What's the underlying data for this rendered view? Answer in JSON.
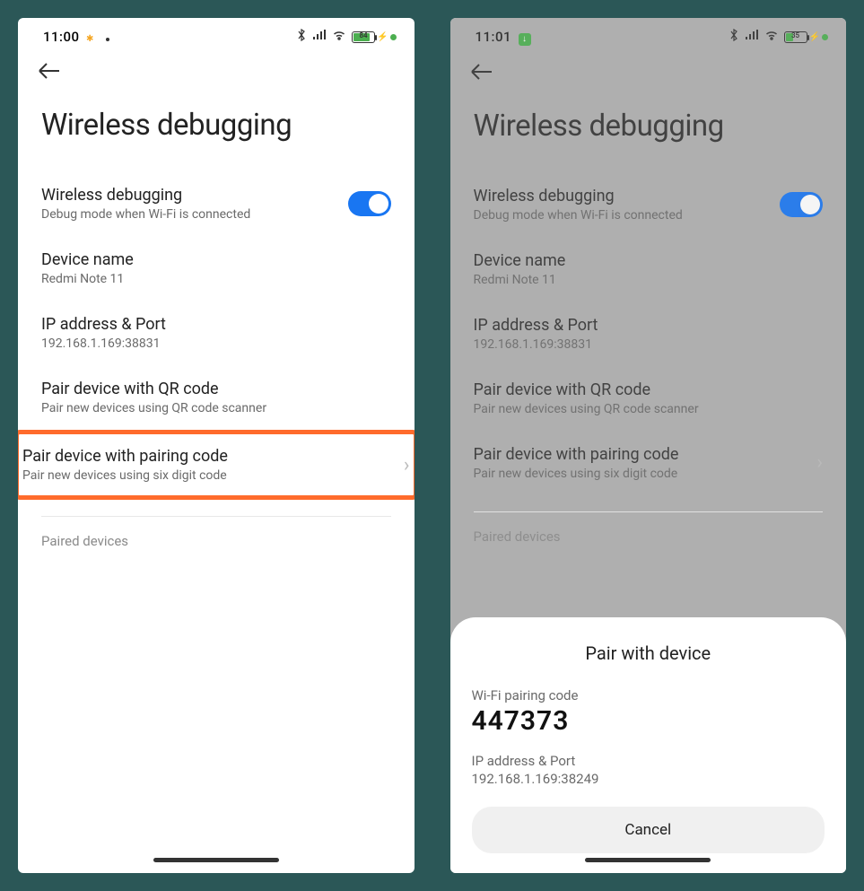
{
  "left": {
    "status": {
      "time": "11:00",
      "battery_pct": "84"
    },
    "page_title": "Wireless debugging",
    "toggle": {
      "title": "Wireless debugging",
      "subtitle": "Debug mode when Wi-Fi is connected"
    },
    "device_name": {
      "title": "Device name",
      "value": "Redmi Note 11"
    },
    "ip_port": {
      "title": "IP address & Port",
      "value": "192.168.1.169:38831"
    },
    "pair_qr": {
      "title": "Pair device with QR code",
      "subtitle": "Pair new devices using QR code scanner"
    },
    "pair_code": {
      "title": "Pair device with pairing code",
      "subtitle": "Pair new devices using six digit code"
    },
    "paired_label": "Paired devices"
  },
  "right": {
    "status": {
      "time": "11:01",
      "battery_pct": "35"
    },
    "page_title": "Wireless debugging",
    "toggle": {
      "title": "Wireless debugging",
      "subtitle": "Debug mode when Wi-Fi is connected"
    },
    "device_name": {
      "title": "Device name",
      "value": "Redmi Note 11"
    },
    "ip_port": {
      "title": "IP address & Port",
      "value": "192.168.1.169:38831"
    },
    "pair_qr": {
      "title": "Pair device with QR code",
      "subtitle": "Pair new devices using QR code scanner"
    },
    "pair_code": {
      "title": "Pair device with pairing code",
      "subtitle": "Pair new devices using six digit code"
    },
    "paired_label": "Paired devices",
    "sheet": {
      "title": "Pair with device",
      "code_label": "Wi-Fi pairing code",
      "code": "447373",
      "ip_label": "IP address & Port",
      "ip": "192.168.1.169:38249",
      "cancel": "Cancel"
    }
  }
}
